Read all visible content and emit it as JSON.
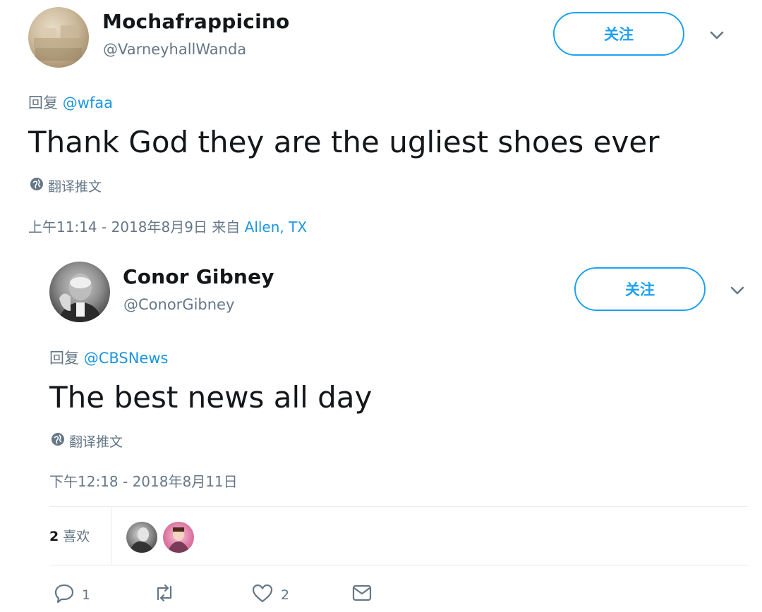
{
  "tweet1": {
    "display_name": "Mochafrappicino",
    "handle": "@VarneyhallWanda",
    "follow_label": "关注",
    "reply_prefix": "回复",
    "reply_to": "@wfaa",
    "text": "Thank God they are the ugliest shoes ever",
    "translate_label": "翻译推文",
    "timestamp": "上午11:14 - 2018年8月9日",
    "from_label": "来自",
    "location": "Allen, TX"
  },
  "tweet2": {
    "display_name": "Conor Gibney",
    "handle": "@ConorGibney",
    "follow_label": "关注",
    "reply_prefix": "回复",
    "reply_to": "@CBSNews",
    "text": "The best news all day",
    "translate_label": "翻译推文",
    "timestamp": "下午12:18 - 2018年8月11日",
    "likes_count": "2",
    "likes_label": "喜欢",
    "actions": {
      "reply_count": "1",
      "retweet_count": "",
      "like_count": "2"
    }
  },
  "colors": {
    "accent": "#1da1f2",
    "link": "#1b95e0",
    "muted": "#657786",
    "text": "#14171a"
  },
  "icons": [
    "chevron-down-icon",
    "globe-icon",
    "reply-icon",
    "retweet-icon",
    "heart-icon",
    "message-icon"
  ]
}
